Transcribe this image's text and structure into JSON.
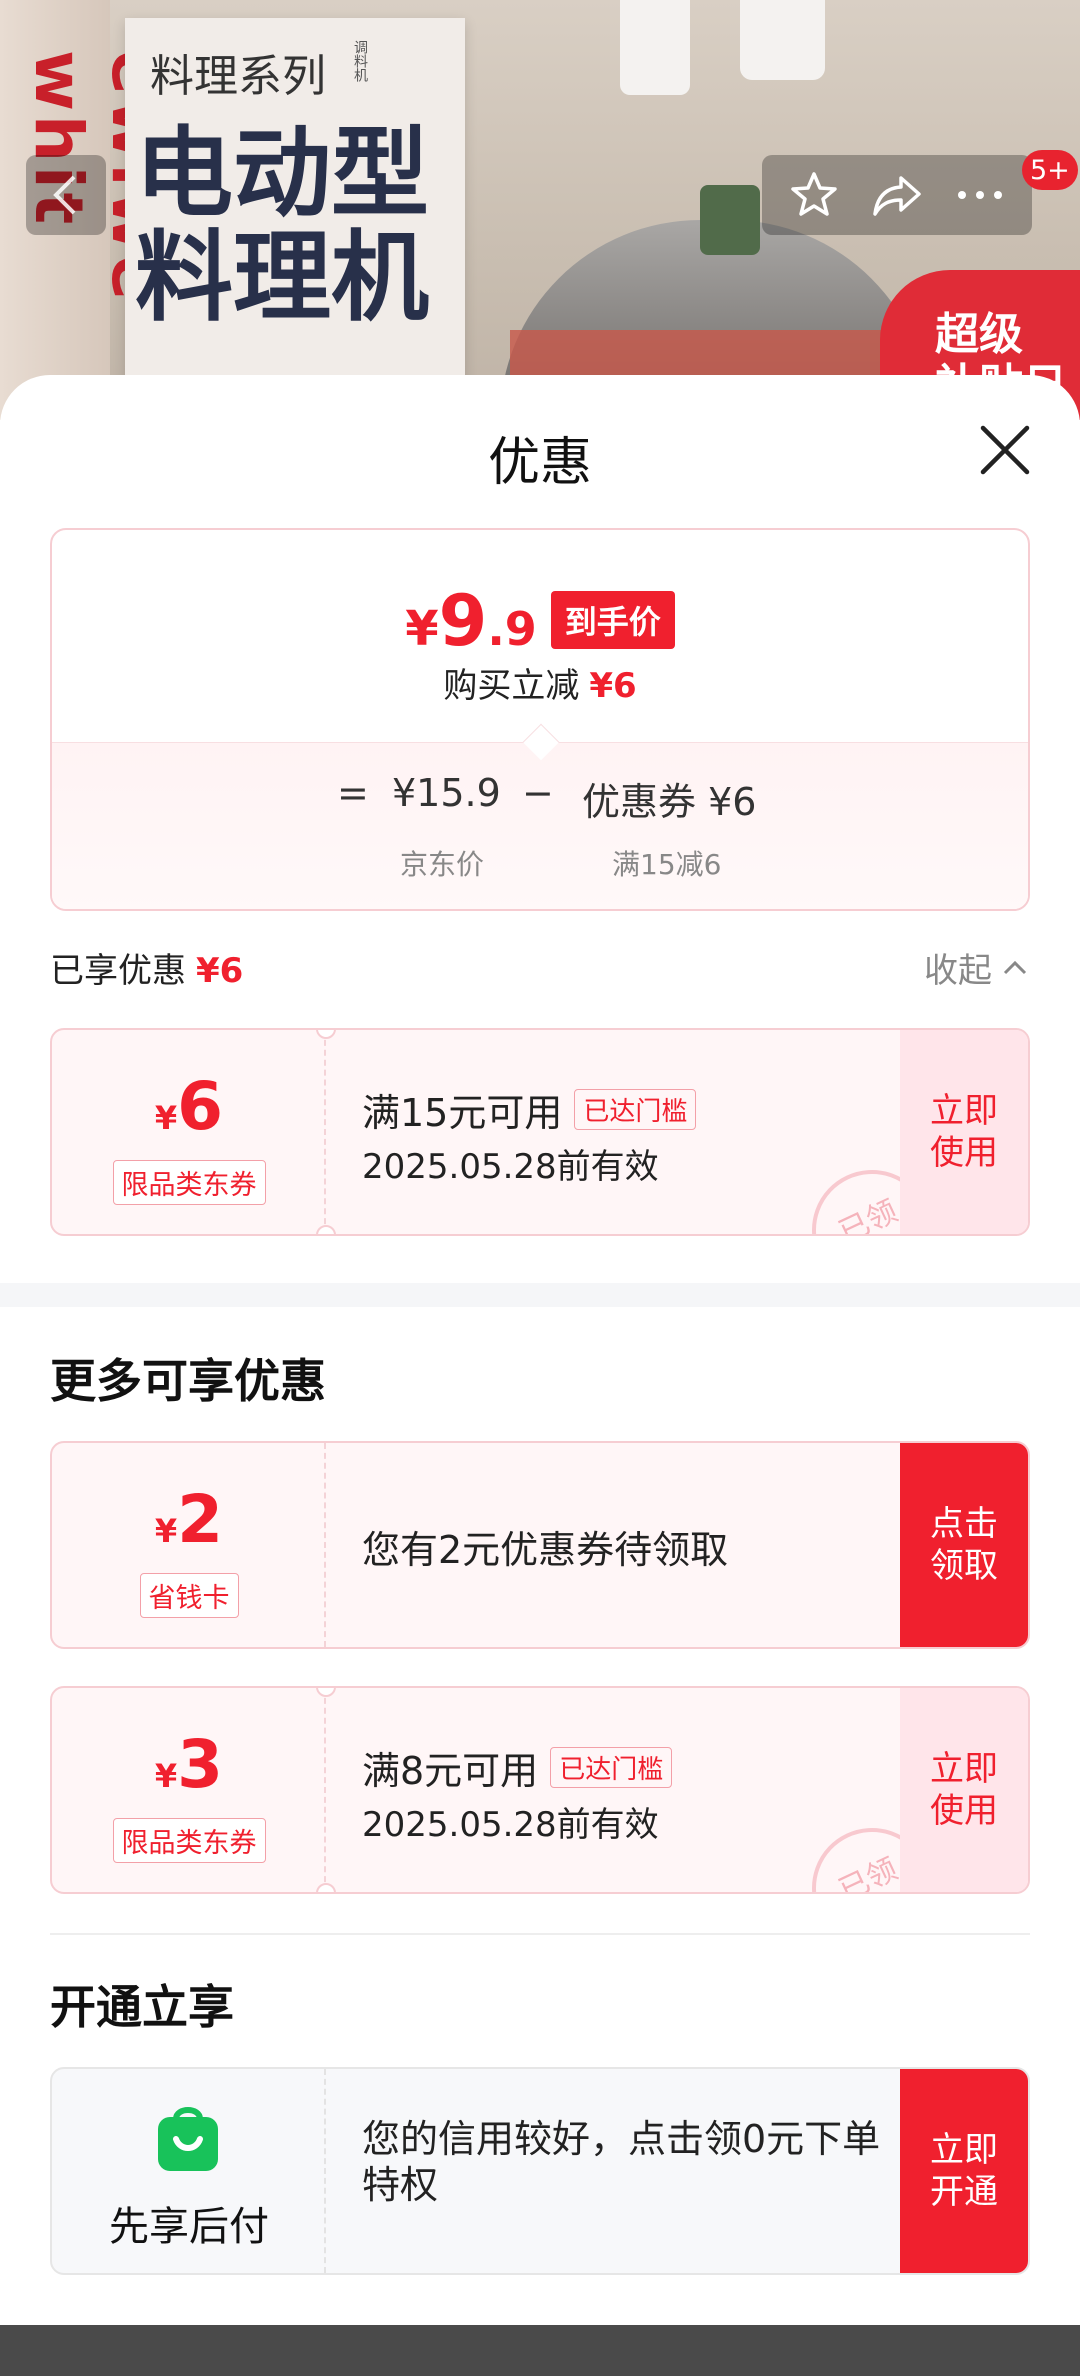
{
  "product": {
    "series_text": "料理系列",
    "series_small": "调料机",
    "headline_1": "电动型",
    "headline_2": "料理机",
    "brand_vertical": "ewiwe whit",
    "badge_line1": "超级",
    "badge_line2": "补贴日"
  },
  "nav": {
    "notification_count": "5+"
  },
  "sheet": {
    "title": "优惠"
  },
  "summary": {
    "price_yen": "¥",
    "price_int": "9",
    "price_dec": ".9",
    "final_tag": "到手价",
    "reduce_label": "购买立减",
    "reduce_amount": "¥6",
    "eq": "=",
    "jd_price": "¥15.9",
    "minus": "−",
    "coupon_label": "优惠券 ¥6",
    "jd_price_label": "京东价",
    "coupon_rule": "满15减6"
  },
  "enjoyed": {
    "label": "已享优惠",
    "amount": "¥6",
    "collapse": "收起"
  },
  "coupons": [
    {
      "yen": "¥",
      "amount": "6",
      "type": "限品类东券",
      "condition": "满15元可用",
      "reached": "已达门槛",
      "validity": "2025.05.28前有效",
      "action_1": "立即",
      "action_2": "使用",
      "stamp": "已领"
    },
    {
      "yen": "¥",
      "amount": "2",
      "type": "省钱卡",
      "condition": "您有2元优惠券待领取",
      "action_1": "点击",
      "action_2": "领取"
    },
    {
      "yen": "¥",
      "amount": "3",
      "type": "限品类东券",
      "condition": "满8元可用",
      "reached": "已达门槛",
      "validity": "2025.05.28前有效",
      "action_1": "立即",
      "action_2": "使用",
      "stamp": "已领"
    }
  ],
  "more_section": {
    "title": "更多可享优惠"
  },
  "open_section": {
    "title": "开通立享",
    "label": "先享后付",
    "info": "您的信用较好，点击领0元下单特权",
    "action_1": "立即",
    "action_2": "开通"
  },
  "colors": {
    "accent_red": "#f0202e",
    "pay_green": "#18c25a"
  }
}
